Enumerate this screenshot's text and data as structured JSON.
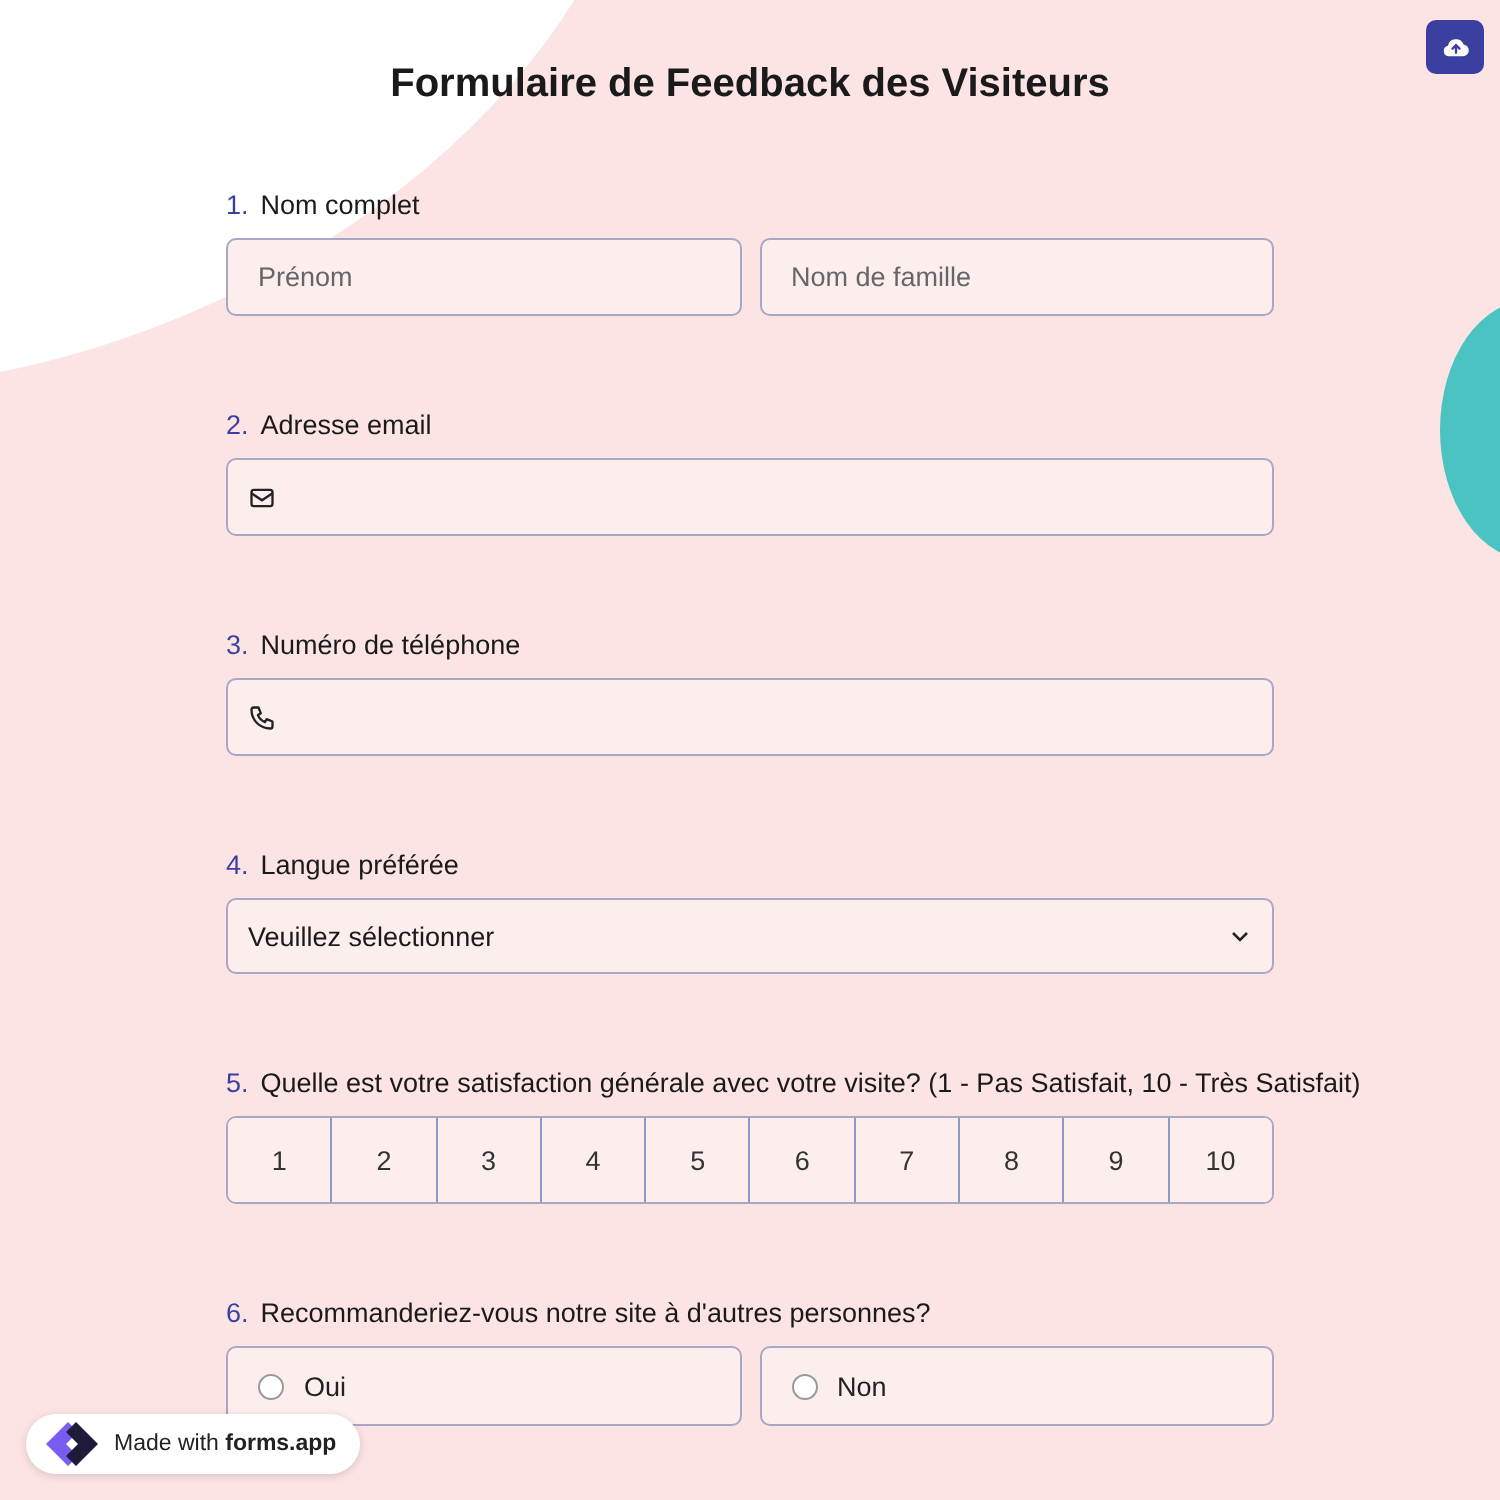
{
  "title": "Formulaire de Feedback des Visiteurs",
  "questions": [
    {
      "number": "1.",
      "label": "Nom complet",
      "kind": "name",
      "fields": [
        {
          "placeholder": "Prénom"
        },
        {
          "placeholder": "Nom de famille"
        }
      ]
    },
    {
      "number": "2.",
      "label": "Adresse email",
      "kind": "email"
    },
    {
      "number": "3.",
      "label": "Numéro de téléphone",
      "kind": "phone"
    },
    {
      "number": "4.",
      "label": "Langue préférée",
      "kind": "select",
      "value": "Veuillez sélectionner"
    },
    {
      "number": "5.",
      "label": "Quelle est votre satisfaction générale avec votre visite? (1 - Pas Satisfait, 10 - Très Satisfait)",
      "kind": "rating",
      "options": [
        {
          "label": "1",
          "selected": false
        },
        {
          "label": "2",
          "selected": false
        },
        {
          "label": "3",
          "selected": false
        },
        {
          "label": "4",
          "selected": false
        },
        {
          "label": "5",
          "selected": false
        },
        {
          "label": "6",
          "selected": false
        },
        {
          "label": "7",
          "selected": false
        },
        {
          "label": "8",
          "selected": false
        },
        {
          "label": "9",
          "selected": false
        },
        {
          "label": "10",
          "selected": false
        }
      ]
    },
    {
      "number": "6.",
      "label": "Recommanderiez-vous notre site à d'autres personnes?",
      "kind": "choice",
      "options": [
        {
          "label": "Oui",
          "selected": false
        },
        {
          "label": "Non",
          "selected": false
        }
      ]
    }
  ],
  "badge": "Made with **forms.app**"
}
